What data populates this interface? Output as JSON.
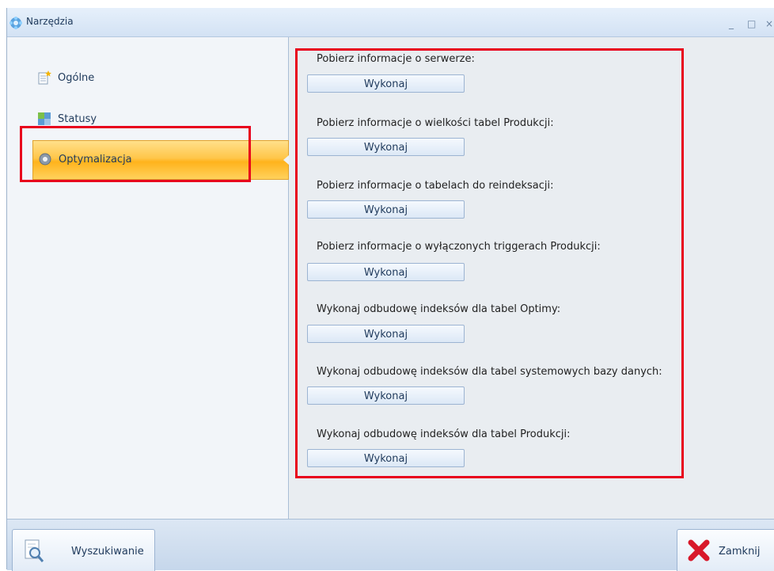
{
  "window": {
    "title": "Narzędzia",
    "minimize_glyph": "_",
    "maximize_glyph": "□",
    "close_glyph": "×"
  },
  "sidebar": {
    "items": [
      {
        "label": "Ogólne",
        "icon": "document-icon"
      },
      {
        "label": "Statusy",
        "icon": "status-icon"
      },
      {
        "label": "Optymalizacja",
        "icon": "gear-icon",
        "active": true
      }
    ]
  },
  "tasks": [
    {
      "description": "Pobierz informacje o serwerze:",
      "button": "Wykonaj"
    },
    {
      "description": "Pobierz informacje o wielkości tabel Produkcji:",
      "button": "Wykonaj"
    },
    {
      "description": "Pobierz informacje o tabelach do reindeksacji:",
      "button": "Wykonaj"
    },
    {
      "description": "Pobierz informacje o wyłączonych triggerach Produkcji:",
      "button": "Wykonaj"
    },
    {
      "description": "Wykonaj odbudowę indeksów dla tabel Optimy:",
      "button": "Wykonaj"
    },
    {
      "description": "Wykonaj odbudowę indeksów dla tabel systemowych bazy danych:",
      "button": "Wykonaj"
    },
    {
      "description": "Wykonaj odbudowę indeksów dla tabel Produkcji:",
      "button": "Wykonaj"
    }
  ],
  "bottom": {
    "search_label": "Wyszukiwanie",
    "close_label": "Zamknij"
  },
  "colors": {
    "highlight": "#e8001c",
    "active_item": "#ffc64a",
    "accent": "#1e395b"
  }
}
